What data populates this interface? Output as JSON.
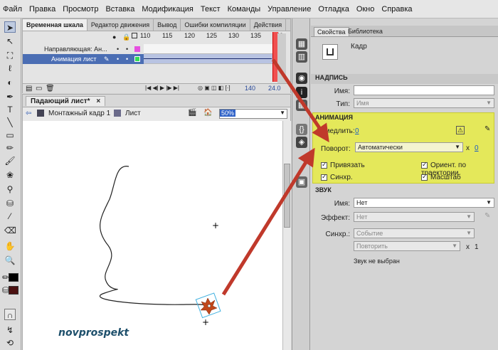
{
  "menu": [
    "Файл",
    "Правка",
    "Просмотр",
    "Вставка",
    "Модификация",
    "Текст",
    "Команды",
    "Управление",
    "Отладка",
    "Окно",
    "Справка"
  ],
  "timeline": {
    "tabs": [
      "Временная шкала",
      "Редактор движения",
      "Вывод",
      "Ошибки компиляции",
      "Действия"
    ],
    "ruler": [
      "110",
      "115",
      "120",
      "125",
      "130",
      "135",
      "140"
    ],
    "layers": [
      {
        "name": "Направляющая: Ан...",
        "selected": false
      },
      {
        "name": "Анимация лист",
        "selected": true
      }
    ],
    "status_frame": "140",
    "status_fps": "24.0"
  },
  "stage": {
    "doc_tab": "Падающий лист*",
    "scene": "Монтажный кадр 1",
    "symbol": "Лист",
    "zoom": "50%",
    "watermark": "novprospekt"
  },
  "props": {
    "tabs": [
      "Свойства",
      "Библиотека"
    ],
    "kind": "Кадр",
    "label_section": "НАДПИСЬ",
    "name_label": "Имя:",
    "name_value": "",
    "type_label": "Тип:",
    "type_value": "Имя",
    "anim_section": "АНИМАЦИЯ",
    "ease_label": "Замедлить:",
    "ease_value": "0",
    "rotate_label": "Поворот:",
    "rotate_value": "Автоматически",
    "rotate_times": "0",
    "x_sign": "x",
    "cb_snap": "Привязать",
    "cb_orient": "Ориент. по траектории",
    "cb_sync": "Синхр.",
    "cb_scale": "Масштаб",
    "sound_section": "ЗВУК",
    "sound_name_label": "Имя:",
    "sound_name_value": "Нет",
    "effect_label": "Эффект:",
    "effect_value": "Нет",
    "sync_label": "Синхр.:",
    "sync_value": "Событие",
    "repeat_value": "Повторить",
    "repeat_times": "1",
    "no_sound": "Звук не выбран"
  },
  "colors": {
    "highlight": "#e4e85a",
    "arrow": "#c0392b",
    "selection": "#4b6eb4"
  }
}
